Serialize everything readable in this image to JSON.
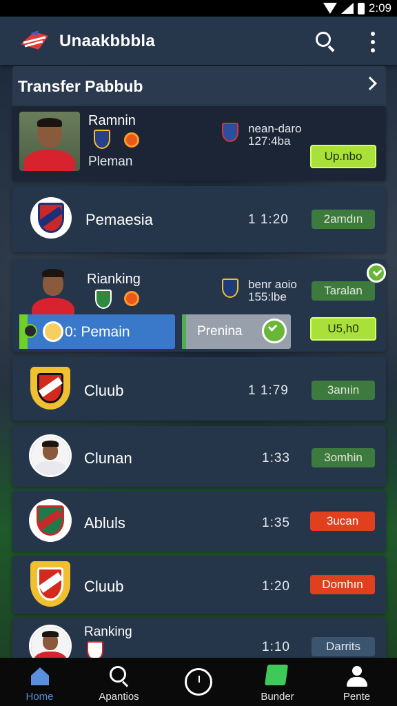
{
  "status_bar": {
    "time": "2:09"
  },
  "app_bar": {
    "title": "Unaakbbbla"
  },
  "section": {
    "title": "Transfer Pabbub"
  },
  "rows": [
    {
      "name": "Ramnin",
      "subname": "Pleman",
      "meta_line1": "nean-daro",
      "meta_line2": "127:4ba",
      "badge": "Up.nbo",
      "badge_style": "lime"
    },
    {
      "name": "Pemaesia",
      "time": "1 1:20",
      "badge": "2amdın",
      "badge_style": "green"
    },
    {
      "name": "Rianking",
      "meta_line1": "benr aoio",
      "meta_line2": "155:lbe",
      "badge": "Taralan",
      "badge_style": "green",
      "badge2": "U5,h0",
      "badge2_style": "lime"
    },
    {
      "name": "Cluub",
      "time": "1 1:79",
      "badge": "3anıin",
      "badge_style": "green"
    },
    {
      "name": "Clunan",
      "time": "1:33",
      "badge": "3omhin",
      "badge_style": "green"
    },
    {
      "name": "Abluls",
      "time": "1:35",
      "badge": "3ucan",
      "badge_style": "red"
    },
    {
      "name": "Cluub",
      "time": "1:20",
      "badge": "Domhın",
      "badge_style": "red"
    },
    {
      "name": "Ranking",
      "time": "1:10",
      "badge": "Darrits",
      "badge_style": "slate"
    }
  ],
  "chips": {
    "pemain": "0: Pemain",
    "premia": "Prenina"
  },
  "bottom_nav": [
    {
      "label": "Home",
      "icon": "home-icon",
      "active": true
    },
    {
      "label": "Apantios",
      "icon": "search-icon"
    },
    {
      "label": "",
      "icon": "circle-icon"
    },
    {
      "label": "Bunder",
      "icon": "card-icon"
    },
    {
      "label": "Pente",
      "icon": "person-icon"
    }
  ],
  "colors": {
    "app_bar": "#26364b",
    "card": "#26364a",
    "badge_green": "#3d7a3e",
    "badge_lime": "#a9e13a",
    "badge_red": "#e0401e",
    "badge_slate": "#3c556e",
    "nav_active": "#5b8edc",
    "chip_blue": "#3a78c9"
  }
}
